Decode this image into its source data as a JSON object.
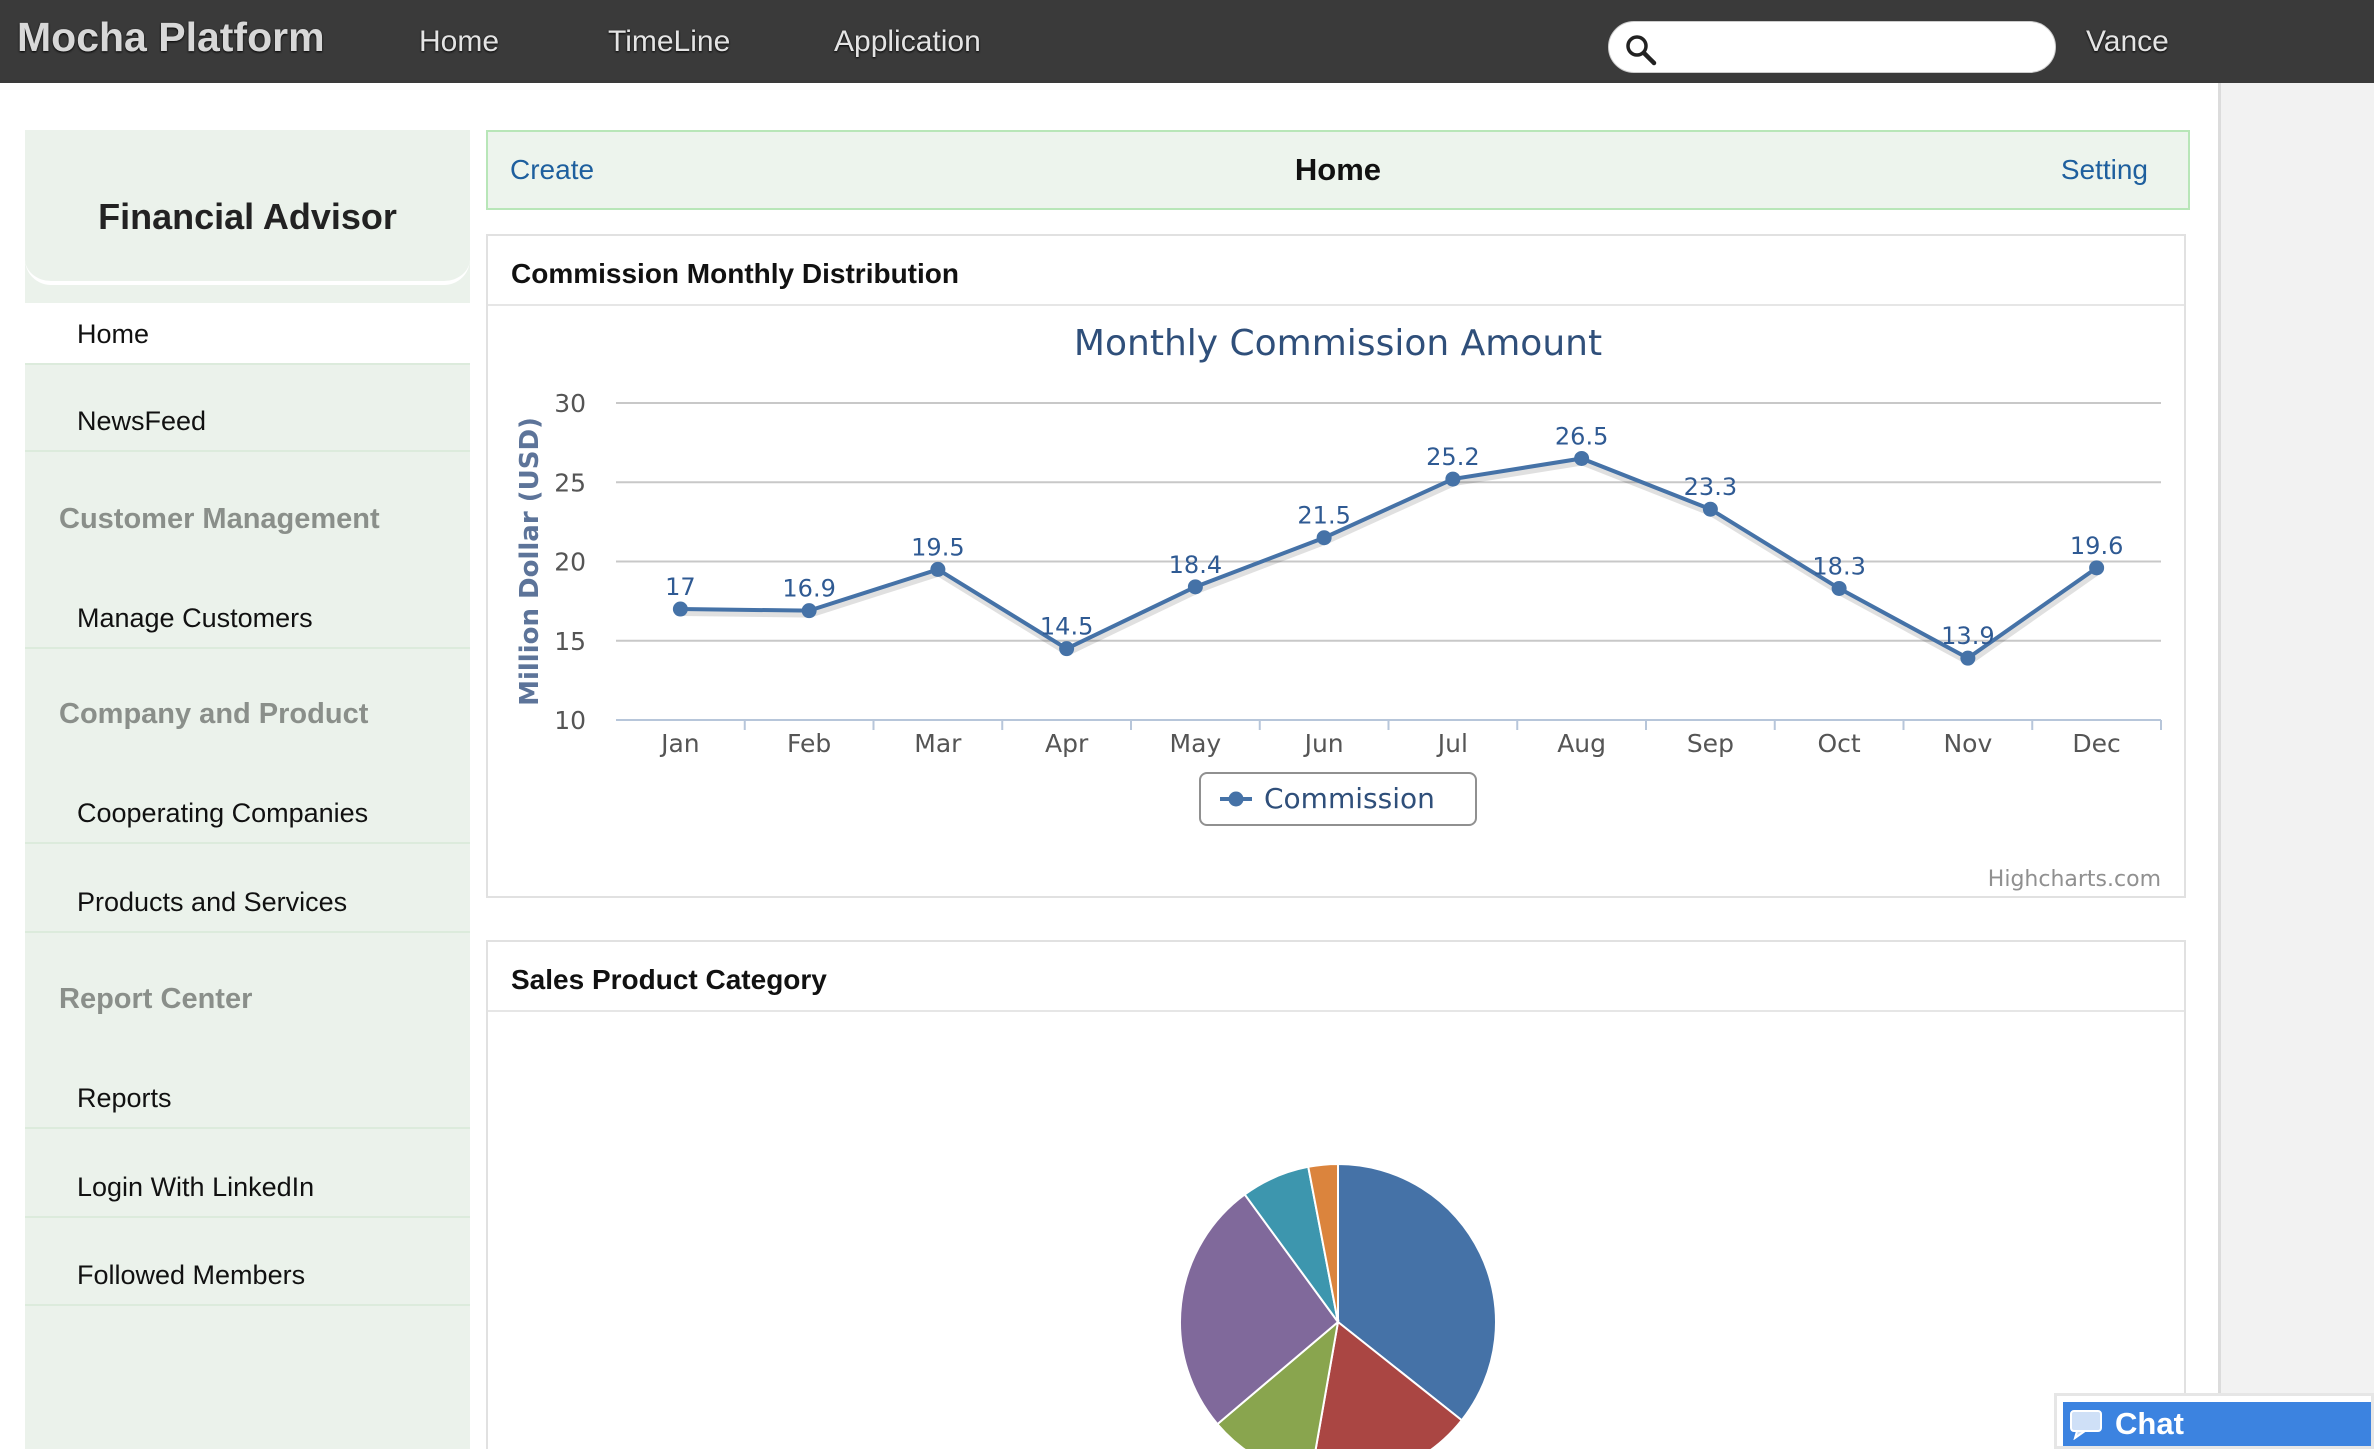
{
  "app": {
    "brand": "Mocha Platform"
  },
  "nav": {
    "items": [
      {
        "label": "Home"
      },
      {
        "label": "TimeLine"
      },
      {
        "label": "Application"
      }
    ]
  },
  "search": {
    "value": "",
    "placeholder": ""
  },
  "user": {
    "name": "Vance"
  },
  "sidebar": {
    "title": "Financial Advisor",
    "home": "Home",
    "newsfeed": "NewsFeed",
    "section_customer": "Customer Management",
    "manage_customers": "Manage Customers",
    "section_company": "Company and Product",
    "cooperating_companies": "Cooperating Companies",
    "products_services": "Products and Services",
    "section_report": "Report Center",
    "reports": "Reports",
    "login_linkedin": "Login With LinkedIn",
    "followed_members": "Followed Members"
  },
  "header": {
    "create": "Create",
    "title": "Home",
    "setting": "Setting"
  },
  "panels": {
    "commission": {
      "title": "Commission Monthly Distribution"
    },
    "sales": {
      "title": "Sales Product Category"
    }
  },
  "chat": {
    "label": "Chat"
  },
  "chart_data": [
    {
      "type": "line",
      "title": "Monthly Commission Amount",
      "xlabel": "",
      "ylabel": "Million Dollar (USD)",
      "ylim": [
        10,
        30
      ],
      "yticks": [
        10,
        15,
        20,
        25,
        30
      ],
      "categories": [
        "Jan",
        "Feb",
        "Mar",
        "Apr",
        "May",
        "Jun",
        "Jul",
        "Aug",
        "Sep",
        "Oct",
        "Nov",
        "Dec"
      ],
      "series": [
        {
          "name": "Commission",
          "values": [
            17,
            16.9,
            19.5,
            14.5,
            18.4,
            21.5,
            25.2,
            26.5,
            23.3,
            18.3,
            13.9,
            19.6
          ],
          "color": "#4572a7"
        }
      ],
      "legend": "bottom-center",
      "grid": true,
      "credits": "Highcharts.com"
    },
    {
      "type": "pie",
      "slices": [
        {
          "value": 35.5,
          "color": "#4572a7"
        },
        {
          "value": 17,
          "color": "#aa4643"
        },
        {
          "value": 11,
          "color": "#89a54e"
        },
        {
          "value": 26,
          "color": "#80699b"
        },
        {
          "value": 7,
          "color": "#3d96ae"
        },
        {
          "value": 3,
          "color": "#db843d"
        }
      ]
    }
  ]
}
